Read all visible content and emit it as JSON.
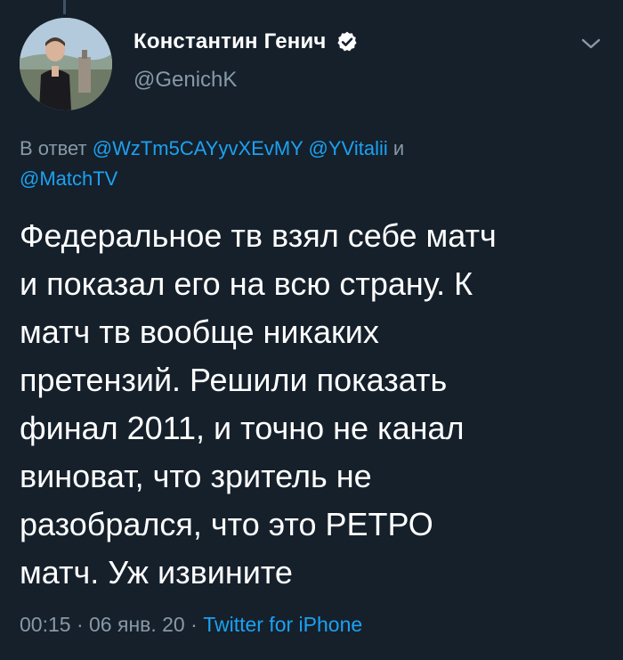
{
  "tweet": {
    "author": {
      "display_name": "Константин Генич",
      "handle": "@GenichK",
      "verified": true
    },
    "reply": {
      "prefix": "В ответ",
      "mention_1": "@WzTm5CAYyvXEvMY",
      "mention_2": "@YVitalii",
      "conjunction": "и",
      "mention_3": "@MatchTV"
    },
    "text_lines": [
      "Федеральное тв взял себе матч",
      "и показал его на всю страну. К",
      "матч тв вообще никаких",
      "претензий. Решили показать",
      "финал 2011, и точно не канал",
      "виноват, что зритель не",
      "разобрался, что это РЕТРО",
      "матч. Уж извините"
    ],
    "time": "00:15",
    "separator": "·",
    "date": "06 янв. 20",
    "source": "Twitter for iPhone"
  },
  "icons": {
    "verified": "verified-badge-icon",
    "menu": "chevron-down-icon"
  },
  "colors": {
    "background": "#15202b",
    "text": "#ffffff",
    "secondary": "#8899a6",
    "accent": "#1da1f2"
  }
}
